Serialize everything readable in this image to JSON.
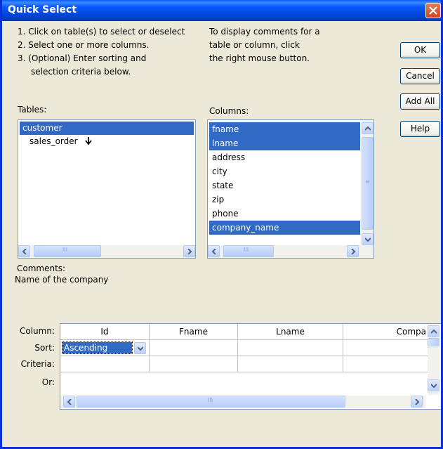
{
  "window": {
    "title": "Quick Select"
  },
  "instructions": [
    "1. Click on table(s) to select or deselect",
    "2. Select one or more columns.",
    "3. (Optional) Enter sorting and",
    "    selection criteria below."
  ],
  "comments_hint": [
    "To display comments for a",
    "table or column, click",
    "the right mouse button."
  ],
  "buttons": {
    "ok": "OK",
    "cancel": "Cancel",
    "add_all": "Add All",
    "help": "Help"
  },
  "tables": {
    "label": "Tables:",
    "items": [
      "customer",
      "sales_order"
    ],
    "selected": "customer"
  },
  "columns": {
    "label": "Columns:",
    "items": [
      "fname",
      "lname",
      "address",
      "city",
      "state",
      "zip",
      "phone",
      "company_name"
    ],
    "selected": [
      "fname",
      "lname",
      "company_name"
    ]
  },
  "comments": {
    "label": "Comments:",
    "text": "Name of the company"
  },
  "criteria": {
    "row_labels": {
      "column": "Column:",
      "sort": "Sort:",
      "criteria": "Criteria:",
      "or": "Or:"
    },
    "columns": [
      "Id",
      "Fname",
      "Lname",
      "Compa"
    ],
    "sort_value": "Ascending"
  },
  "colors": {
    "titlebar": "#0A5CFF",
    "selection": "#316AC5",
    "background": "#ECE9D8"
  },
  "icons": [
    "close-icon",
    "scroll-left-icon",
    "scroll-right-icon",
    "scroll-up-icon",
    "scroll-down-icon",
    "dropdown-arrow-icon",
    "cursor-arrow-icon"
  ]
}
